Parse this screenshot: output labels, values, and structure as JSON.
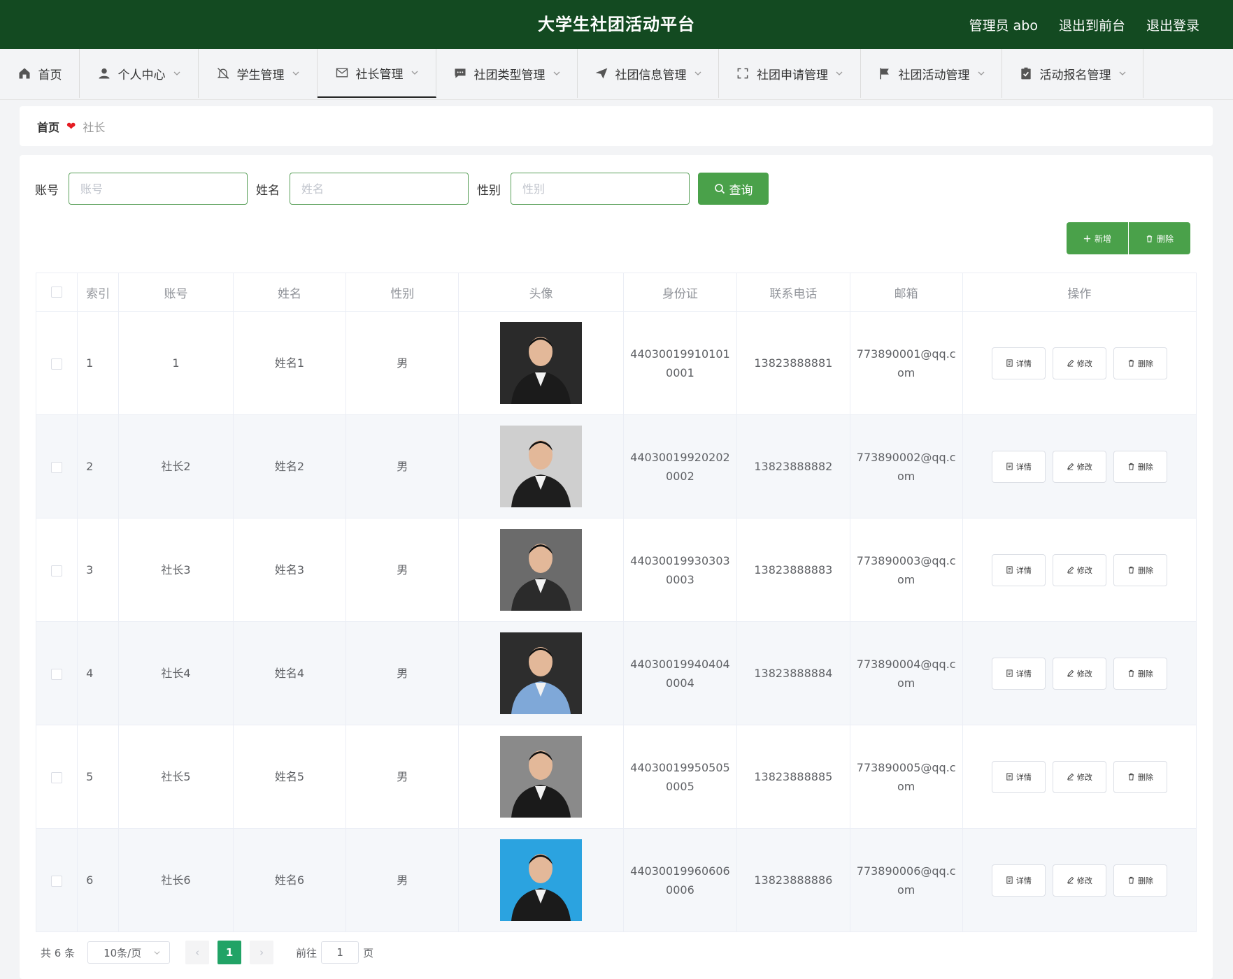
{
  "header": {
    "title": "大学生社团活动平台",
    "admin": "管理员 abo",
    "to_front": "退出到前台",
    "logout": "退出登录"
  },
  "nav": [
    {
      "label": "首页",
      "icon": "home-icon",
      "has_dropdown": false
    },
    {
      "label": "个人中心",
      "icon": "user-icon",
      "has_dropdown": true
    },
    {
      "label": "学生管理",
      "icon": "bell-off-icon",
      "has_dropdown": true
    },
    {
      "label": "社长管理",
      "icon": "mail-icon",
      "has_dropdown": true,
      "active": true
    },
    {
      "label": "社团类型管理",
      "icon": "chat-bubble-icon",
      "has_dropdown": true
    },
    {
      "label": "社团信息管理",
      "icon": "paper-plane-icon",
      "has_dropdown": true
    },
    {
      "label": "社团申请管理",
      "icon": "fullscreen-icon",
      "has_dropdown": true
    },
    {
      "label": "社团活动管理",
      "icon": "flag-icon",
      "has_dropdown": true
    },
    {
      "label": "活动报名管理",
      "icon": "clipboard-check-icon",
      "has_dropdown": true
    }
  ],
  "breadcrumb": {
    "home": "首页",
    "separator_icon": "heart-icon",
    "current": "社长"
  },
  "search": {
    "account_label": "账号",
    "account_placeholder": "账号",
    "name_label": "姓名",
    "name_placeholder": "姓名",
    "gender_label": "性别",
    "gender_placeholder": "性别",
    "query_label": "查询"
  },
  "actions": {
    "add_label": "新增",
    "delete_label": "删除"
  },
  "table": {
    "columns": [
      "索引",
      "账号",
      "姓名",
      "性别",
      "头像",
      "身份证",
      "联系电话",
      "邮箱",
      "操作"
    ],
    "rows": [
      {
        "index": "1",
        "account": "1",
        "name": "姓名1",
        "gender": "男",
        "id_card": "440300199101010001",
        "phone": "13823888881",
        "email": "773890001@qq.com"
      },
      {
        "index": "2",
        "account": "社长2",
        "name": "姓名2",
        "gender": "男",
        "id_card": "440300199202020002",
        "phone": "13823888882",
        "email": "773890002@qq.com"
      },
      {
        "index": "3",
        "account": "社长3",
        "name": "姓名3",
        "gender": "男",
        "id_card": "440300199303030003",
        "phone": "13823888883",
        "email": "773890003@qq.com"
      },
      {
        "index": "4",
        "account": "社长4",
        "name": "姓名4",
        "gender": "男",
        "id_card": "440300199404040004",
        "phone": "13823888884",
        "email": "773890004@qq.com"
      },
      {
        "index": "5",
        "account": "社长5",
        "name": "姓名5",
        "gender": "男",
        "id_card": "440300199505050005",
        "phone": "13823888885",
        "email": "773890005@qq.com"
      },
      {
        "index": "6",
        "account": "社长6",
        "name": "姓名6",
        "gender": "男",
        "id_card": "440300199606060006",
        "phone": "13823888886",
        "email": "773890006@qq.com"
      }
    ],
    "op_detail": "详情",
    "op_edit": "修改",
    "op_delete": "删除"
  },
  "pager": {
    "total": "共 6 条",
    "page_size": "10条/页",
    "current_page": "1",
    "goto_label": "前往",
    "goto_value": "1",
    "page_suffix": "页"
  },
  "colors": {
    "header_bg": "#134a21",
    "primary": "#4aa14a",
    "page_active": "#21a366"
  }
}
